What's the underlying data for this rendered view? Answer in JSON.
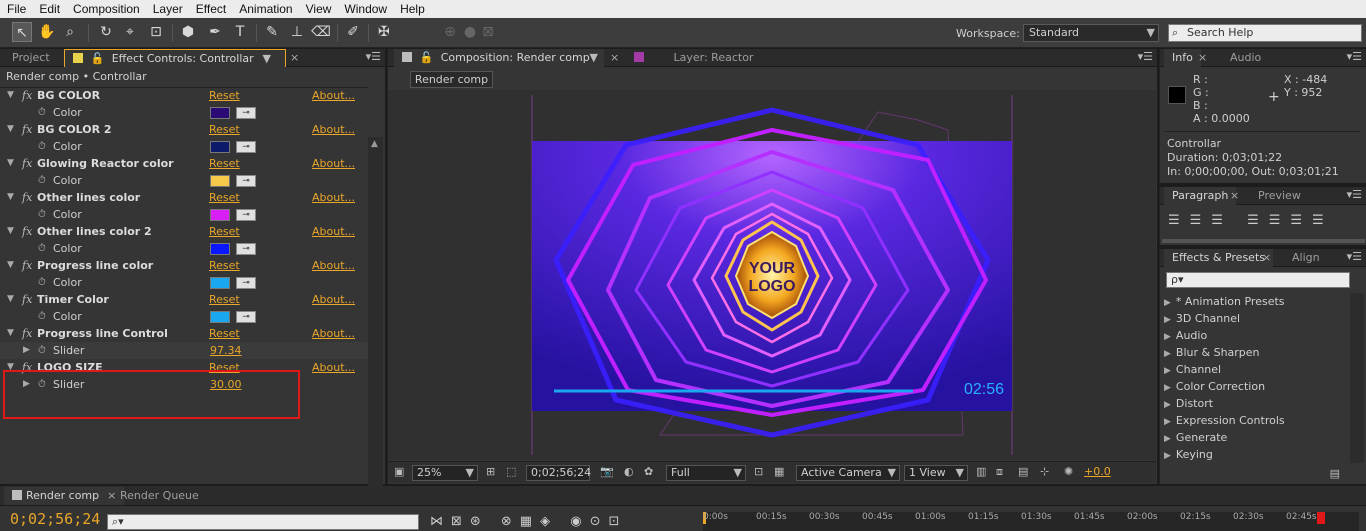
{
  "menu": [
    "File",
    "Edit",
    "Composition",
    "Layer",
    "Effect",
    "Animation",
    "View",
    "Window",
    "Help"
  ],
  "workspace": {
    "label": "Workspace:",
    "value": "Standard"
  },
  "search_help": {
    "placeholder": "Search Help"
  },
  "left_panel": {
    "tabs": [
      "Project",
      "Effect Controls: Controllar"
    ],
    "subtitle": "Render comp • Controllar"
  },
  "effects": [
    {
      "name": "BG COLOR",
      "reset": "Reset",
      "about": "About...",
      "prop": "Color",
      "type": "color",
      "value": "#2a0b75"
    },
    {
      "name": "BG COLOR 2",
      "reset": "Reset",
      "about": "About...",
      "prop": "Color",
      "type": "color",
      "value": "#0c1a6a"
    },
    {
      "name": "Glowing Reactor color",
      "reset": "Reset",
      "about": "About...",
      "prop": "Color",
      "type": "color",
      "value": "#f7c94a"
    },
    {
      "name": "Other lines color",
      "reset": "Reset",
      "about": "About...",
      "prop": "Color",
      "type": "color",
      "value": "#d81ff5"
    },
    {
      "name": "Other lines color 2",
      "reset": "Reset",
      "about": "About...",
      "prop": "Color",
      "type": "color",
      "value": "#0b18ff"
    },
    {
      "name": "Progress line color",
      "reset": "Reset",
      "about": "About...",
      "prop": "Color",
      "type": "color",
      "value": "#19a8ef"
    },
    {
      "name": "Timer Color",
      "reset": "Reset",
      "about": "About...",
      "prop": "Color",
      "type": "color",
      "value": "#19a8ef"
    },
    {
      "name": "Progress line Control",
      "reset": "Reset",
      "about": "About...",
      "prop": "Slider",
      "type": "slider",
      "value": "97.34"
    },
    {
      "name": "LOGO SIZE",
      "reset": "Reset",
      "about": "About...",
      "prop": "Slider",
      "type": "slider",
      "value": "30.00"
    }
  ],
  "comp_panel": {
    "tabs": [
      "Composition: Render comp",
      "Layer: Reactor"
    ],
    "button": "Render comp",
    "logo_text_1": "YOUR",
    "logo_text_2": "LOGO",
    "timer": "02:56"
  },
  "comp_bottom": {
    "zoom": "25%",
    "timecode": "0;02;56;24",
    "resolution": "Full",
    "camera": "Active Camera",
    "views": "1 View",
    "exposure": "+0.0"
  },
  "info_panel": {
    "tabs": [
      "Info",
      "Audio"
    ],
    "r": "R :",
    "g": "G :",
    "b": "B :",
    "a": "A : 0.0000",
    "x": "X : -484",
    "y": "Y : 952",
    "layer": "Controllar",
    "duration": "Duration: 0;03;01;22",
    "in_out": "In: 0;00;00;00, Out: 0;03;01;21"
  },
  "paragraph_panel": {
    "tabs": [
      "Paragraph",
      "Preview"
    ]
  },
  "effects_presets": {
    "tabs": [
      "Effects & Presets",
      "Align"
    ],
    "search_placeholder": "ρ▾",
    "items": [
      "* Animation Presets",
      "3D Channel",
      "Audio",
      "Blur & Sharpen",
      "Channel",
      "Color Correction",
      "Distort",
      "Expression Controls",
      "Generate",
      "Keying"
    ]
  },
  "timeline": {
    "tabs": [
      "Render comp",
      "Render Queue"
    ],
    "timecode": "0;02;56;24",
    "ruler": [
      "0:00s",
      "00:15s",
      "00:30s",
      "00:45s",
      "01:00s",
      "01:15s",
      "01:30s",
      "01:45s",
      "02:00s",
      "02:15s",
      "02:30s",
      "02:45s"
    ]
  },
  "colors": {
    "accent": "#e8a72a",
    "highlight": "#e01818"
  }
}
